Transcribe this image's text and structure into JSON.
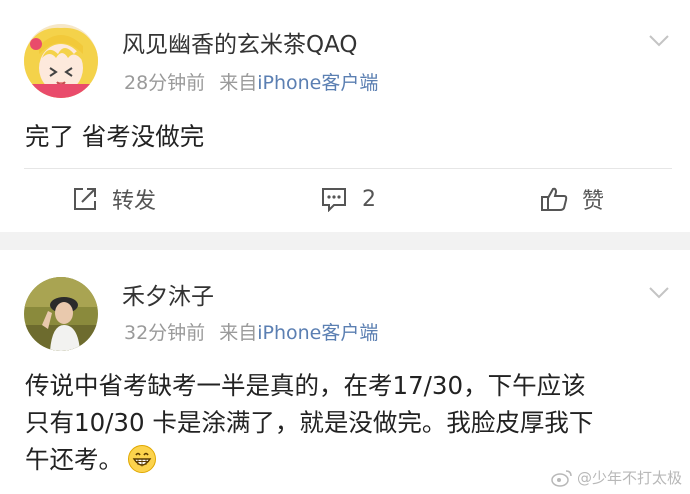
{
  "posts": [
    {
      "username": "风见幽香的玄米茶QAQ",
      "time": "28分钟前",
      "source_prefix": "来自",
      "source": "iPhone客户端",
      "content": "完了 省考没做完",
      "actions": {
        "repost_label": "转发",
        "comment_count": "2",
        "like_label": "赞"
      }
    },
    {
      "username": "禾夕沐子",
      "time": "32分钟前",
      "source_prefix": "来自",
      "source": "iPhone客户端",
      "content_lines": [
        "传说中省考缺考一半是真的，在考17/30，下午应该",
        "只有10/30 卡是涂满了，就是没做完。我脸皮厚我下",
        "午还考。"
      ]
    }
  ],
  "watermark": "@少年不打太极",
  "icons": {
    "repost": "repost-icon",
    "comment": "comment-icon",
    "like": "thumbs-up-icon",
    "menu": "chevron-down-icon",
    "emoji": "grinning-emoji-icon",
    "weibo": "weibo-logo-icon"
  },
  "colors": {
    "source_link": "#5b7fb2",
    "meta_text": "#9a9a9a",
    "section_gap": "#f2f2f2"
  }
}
